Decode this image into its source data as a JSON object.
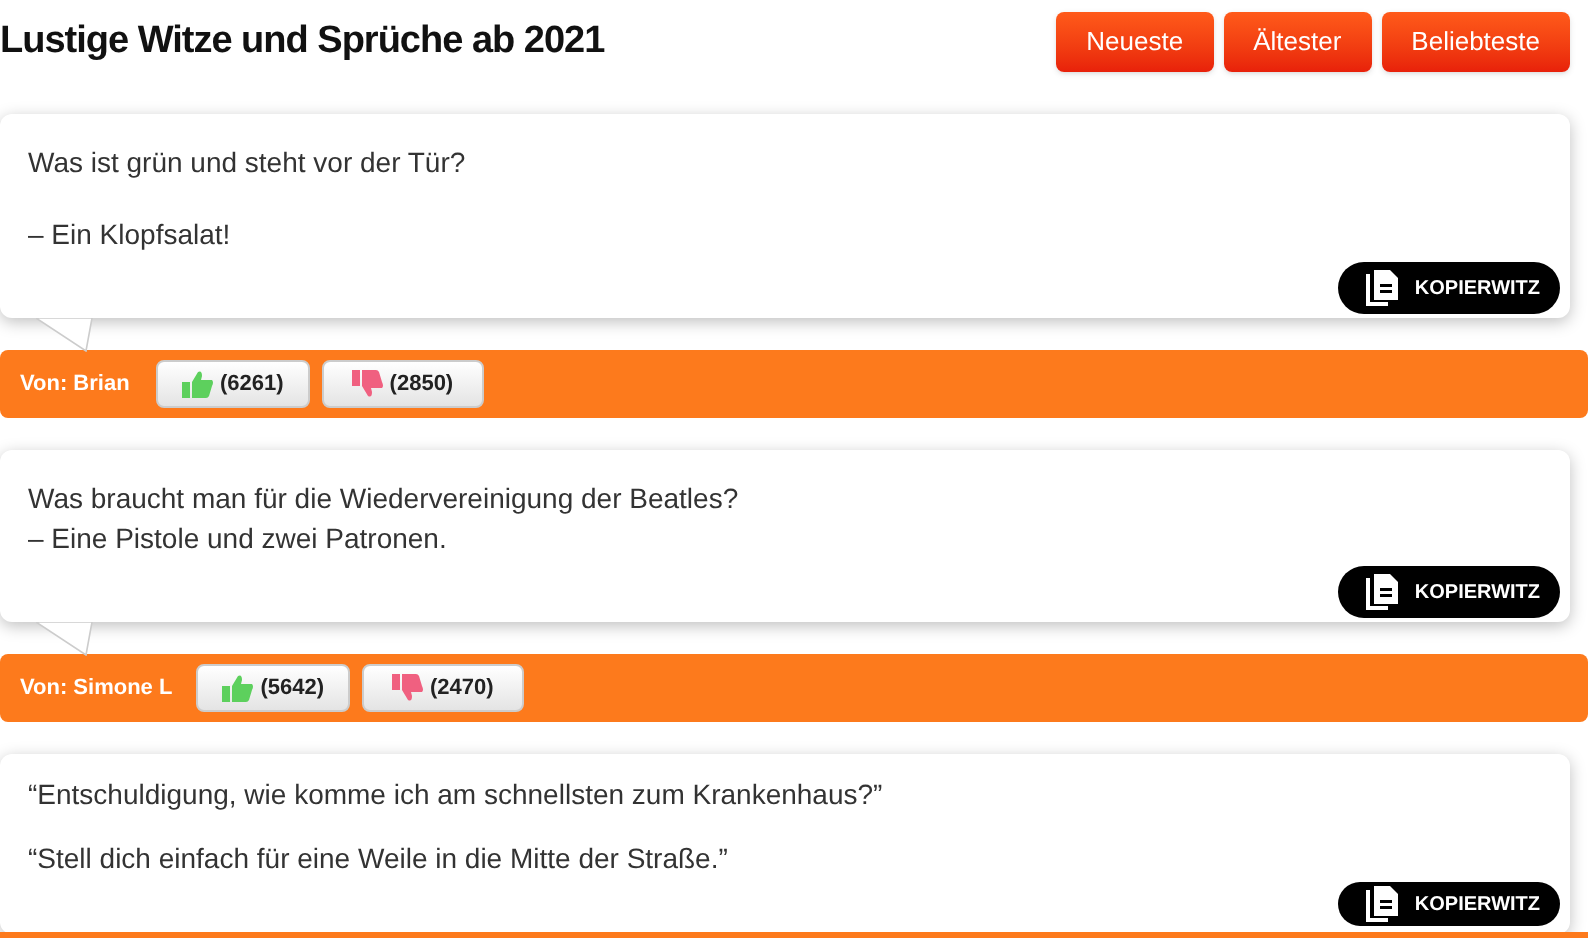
{
  "title": "Lustige Witze und Sprüche ab 2021",
  "sort_buttons": [
    {
      "label": "Neueste"
    },
    {
      "label": "Ältester"
    },
    {
      "label": "Beliebteste"
    }
  ],
  "jokes": [
    {
      "paragraphs": [
        [
          "Was ist grün und steht vor der Tür?"
        ],
        [
          "– Ein Klopfsalat!"
        ]
      ],
      "copy_label": "KOPIERWITZ",
      "author": "Von: Brian",
      "likes": "(6261)",
      "dislikes": "(2850)"
    },
    {
      "paragraphs": [
        [
          "Was braucht man für die Wiedervereinigung der Beatles?",
          "– Eine Pistole und zwei Patronen."
        ]
      ],
      "copy_label": "KOPIERWITZ",
      "author": "Von: Simone L",
      "likes": "(5642)",
      "dislikes": "(2470)"
    },
    {
      "paragraphs": [
        [
          "“Entschuldigung, wie komme ich am schnellsten zum Krankenhaus?”"
        ],
        [
          "“Stell dich einfach für eine Weile in die Mitte der Straße.”"
        ]
      ],
      "copy_label": "KOPIERWITZ"
    }
  ]
}
